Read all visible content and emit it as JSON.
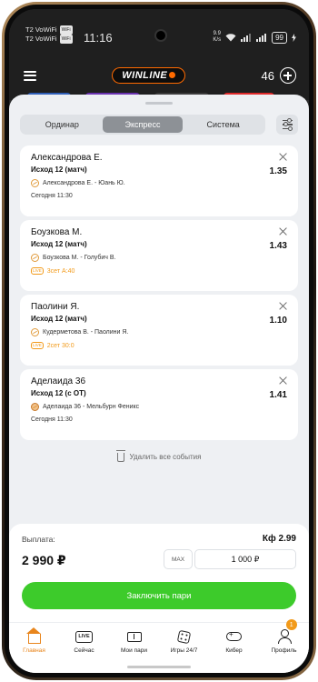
{
  "status": {
    "carrier_line1": "T2 VoWiFi",
    "carrier_line2": "T2 VoWiFi",
    "wifi_tag": "WiFi",
    "time": "11:16",
    "speed_value": "9.9",
    "speed_unit": "K/s",
    "battery": "99"
  },
  "header": {
    "logo": "WINLINE",
    "balance_count": "46"
  },
  "tabs": [
    {
      "label": "Ординар",
      "active": false
    },
    {
      "label": "Экспресс",
      "active": true
    },
    {
      "label": "Система",
      "active": false
    }
  ],
  "tickets": [
    {
      "name": "Александрова Е.",
      "market": "Исход 12 (матч)",
      "match": "Александрова Е. - Юань Ю.",
      "time": "Сегодня 11:30",
      "odds": "1.35",
      "live": false
    },
    {
      "name": "Боузкова М.",
      "market": "Исход 12 (матч)",
      "match": "Боузкова М. - Голубич В.",
      "time": "3сет А:40",
      "odds": "1.43",
      "live": true
    },
    {
      "name": "Паолини Я.",
      "market": "Исход 12 (матч)",
      "match": "Кудерметова В. - Паолини Я.",
      "time": "2сет 30:0",
      "odds": "1.10",
      "live": true
    },
    {
      "name": "Аделаида 36",
      "market": "Исход 12 (с ОТ)",
      "match": "Аделаида 36 - Мельбурн Феникс",
      "time": "Сегодня 11:30",
      "odds": "1.41",
      "live": false
    }
  ],
  "delete_all": "Удалить все события",
  "panel": {
    "payout_label": "Выплата:",
    "coef": "Кф 2.99",
    "payout_value": "2 990 ₽",
    "max_label": "MAX",
    "stake_value": "1 000 ₽",
    "place_bet": "Заключить пари"
  },
  "nav": [
    {
      "label": "Главная",
      "active": true
    },
    {
      "label": "Сейчас",
      "icon_text": "LIVE"
    },
    {
      "label": "Мои пари"
    },
    {
      "label": "Игры 24/7"
    },
    {
      "label": "Кибер"
    },
    {
      "label": "Профиль",
      "badge": "1"
    }
  ],
  "colors": {
    "accent_orange": "#e8851c",
    "place_bet_green": "#3dcb2b",
    "active_tab": "#8d9196"
  }
}
